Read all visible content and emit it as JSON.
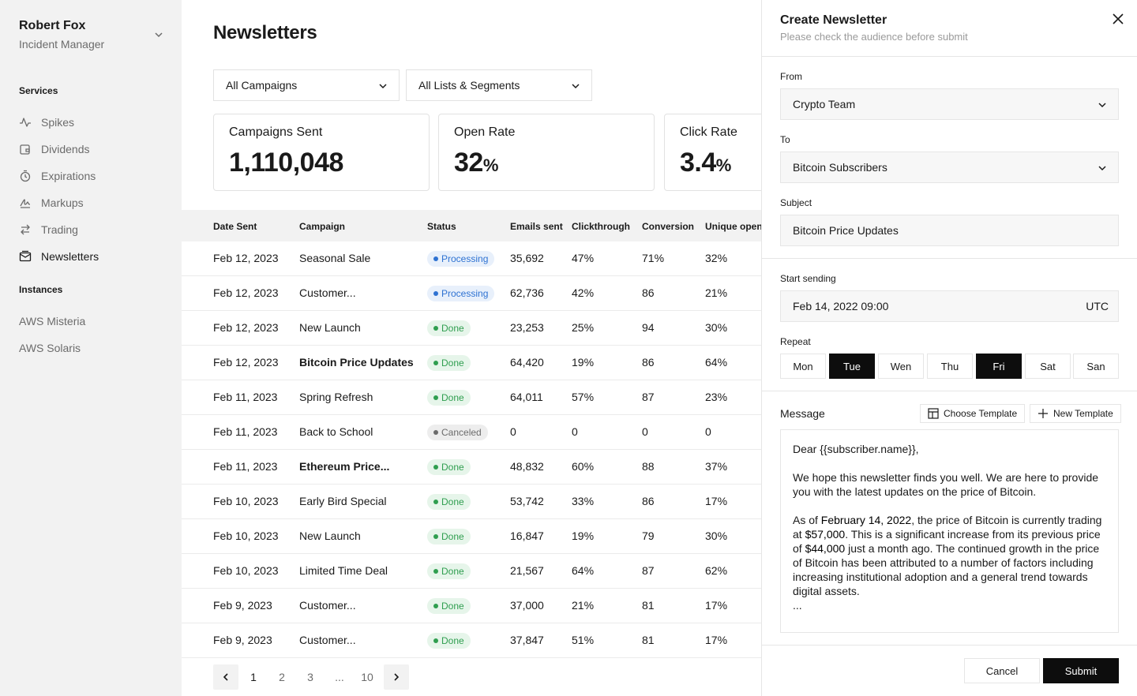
{
  "sidebar": {
    "user": {
      "name": "Robert Fox",
      "role": "Incident Manager"
    },
    "services_label": "Services",
    "services": [
      {
        "label": "Spikes",
        "icon": "activity-icon"
      },
      {
        "label": "Dividends",
        "icon": "wallet-icon"
      },
      {
        "label": "Expirations",
        "icon": "timer-icon"
      },
      {
        "label": "Markups",
        "icon": "signature-icon"
      },
      {
        "label": "Trading",
        "icon": "arrows-exchange-icon"
      },
      {
        "label": "Newsletters",
        "icon": "mail-icon",
        "active": true
      }
    ],
    "instances_label": "Instances",
    "instances": [
      "AWS Misteria",
      "AWS Solaris"
    ]
  },
  "main": {
    "title": "Newsletters",
    "filters": [
      "All Campaigns",
      "All Lists & Segments"
    ],
    "stats": [
      {
        "label": "Campaigns Sent",
        "value": "1,110,048",
        "unit": ""
      },
      {
        "label": "Open Rate",
        "value": "32",
        "unit": "%"
      },
      {
        "label": "Click Rate",
        "value": "3.4",
        "unit": "%"
      }
    ],
    "columns": [
      "Date Sent",
      "Campaign",
      "Status",
      "Emails sent",
      "Clickthrough",
      "Conversion",
      "Unique opens"
    ],
    "rows": [
      {
        "date": "Feb 12, 2023",
        "campaign": "Seasonal Sale",
        "status": "Processing",
        "emails": "35,692",
        "click": "47%",
        "conv": "71%",
        "opens": "32%"
      },
      {
        "date": "Feb 12, 2023",
        "campaign": "Customer...",
        "status": "Processing",
        "emails": "62,736",
        "click": "42%",
        "conv": "86",
        "opens": "21%"
      },
      {
        "date": "Feb 12, 2023",
        "campaign": "New Launch",
        "status": "Done",
        "emails": "23,253",
        "click": "25%",
        "conv": "94",
        "opens": "30%"
      },
      {
        "date": "Feb 12, 2023",
        "campaign": "Bitcoin Price Updates",
        "status": "Done",
        "emails": "64,420",
        "click": "19%",
        "conv": "86",
        "opens": "64%"
      },
      {
        "date": "Feb 11, 2023",
        "campaign": "Spring Refresh",
        "status": "Done",
        "emails": "64,011",
        "click": "57%",
        "conv": "87",
        "opens": "23%"
      },
      {
        "date": "Feb 11, 2023",
        "campaign": "Back to School",
        "status": "Canceled",
        "emails": "0",
        "click": "0",
        "conv": "0",
        "opens": "0"
      },
      {
        "date": "Feb 11, 2023",
        "campaign": "Ethereum Price...",
        "status": "Done",
        "emails": "48,832",
        "click": "60%",
        "conv": "88",
        "opens": "37%"
      },
      {
        "date": "Feb 10, 2023",
        "campaign": "Early Bird Special",
        "status": "Done",
        "emails": "53,742",
        "click": "33%",
        "conv": "86",
        "opens": "17%"
      },
      {
        "date": "Feb 10, 2023",
        "campaign": "New Launch",
        "status": "Done",
        "emails": "16,847",
        "click": "19%",
        "conv": "79",
        "opens": "30%"
      },
      {
        "date": "Feb 10, 2023",
        "campaign": "Limited Time Deal",
        "status": "Done",
        "emails": "21,567",
        "click": "64%",
        "conv": "87",
        "opens": "62%"
      },
      {
        "date": "Feb 9, 2023",
        "campaign": "Customer...",
        "status": "Done",
        "emails": "37,000",
        "click": "21%",
        "conv": "81",
        "opens": "17%"
      },
      {
        "date": "Feb 9, 2023",
        "campaign": "Customer...",
        "status": "Done",
        "emails": "37,847",
        "click": "51%",
        "conv": "81",
        "opens": "17%"
      }
    ],
    "pagination": {
      "pages": [
        "1",
        "2",
        "3",
        "...",
        "10"
      ],
      "current": "1"
    }
  },
  "panel": {
    "title": "Create Newsletter",
    "subtitle": "Please check the audience before submit",
    "from_label": "From",
    "from_value": "Crypto Team",
    "to_label": "To",
    "to_value": "Bitcoin Subscribers",
    "subject_label": "Subject",
    "subject_value": "Bitcoin Price Updates",
    "start_label": "Start sending",
    "start_value": "Feb 14, 2022 09:00",
    "timezone": "UTC",
    "repeat_label": "Repeat",
    "days": [
      {
        "label": "Mon",
        "on": false
      },
      {
        "label": "Tue",
        "on": true
      },
      {
        "label": "Wen",
        "on": false
      },
      {
        "label": "Thu",
        "on": false
      },
      {
        "label": "Fri",
        "on": true
      },
      {
        "label": "Sat",
        "on": false
      },
      {
        "label": "San",
        "on": false
      }
    ],
    "message_label": "Message",
    "choose_template": "Choose Template",
    "new_template": "New Template",
    "message": {
      "greeting": "Dear {{subscriber.name}},",
      "p1": "We hope this newsletter finds you well. We are here to provide you with the latest updates on the price of Bitcoin.",
      "p2_a": "As of ",
      "p2_date": "February 14, 2022",
      "p2_b": ", the price of Bitcoin is currently trading at ",
      "p2_price": "$57,000",
      "p2_c": ". This is a significant increase from its previous price of ",
      "p2_prev": "$44,000",
      "p2_d": " just a month ago. The continued growth in the price of Bitcoin has been attributed to a number of factors including increasing institutional adoption and a general trend towards digital assets.",
      "ellipsis": "..."
    },
    "cancel_label": "Cancel",
    "submit_label": "Submit"
  },
  "colors": {
    "processing": "#2e72d2",
    "done": "#2f9e4f",
    "canceled": "#6b6b6b",
    "primary_button": "#0d0d0d"
  }
}
